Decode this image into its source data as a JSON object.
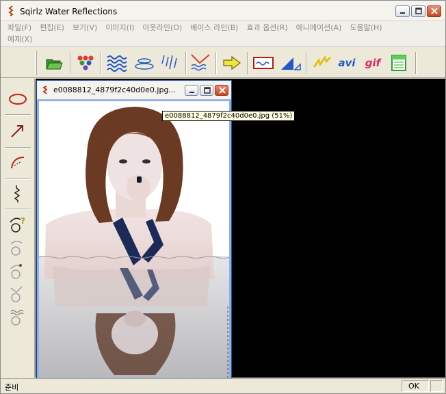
{
  "app": {
    "title": "Sqirlz Water Reflections"
  },
  "menu": {
    "row1": [
      "파일(F)",
      "편집(E)",
      "보기(V)",
      "이미지(I)",
      "아웃라인(O)",
      "베이스 라인(B)",
      "효과 옵션(R)",
      "애니메이션(A)",
      "도움말(H)"
    ],
    "row2": [
      "예제(X)"
    ]
  },
  "toolbar": {
    "buttons": [
      {
        "name": "open-folder-icon"
      },
      {
        "name": "color-dots-icon"
      },
      {
        "name": "waves-icon"
      },
      {
        "name": "ripples-icon"
      },
      {
        "name": "rain-icon"
      },
      {
        "name": "reflection-icon"
      },
      {
        "name": "arrow-right-icon"
      },
      {
        "name": "frame-icon"
      },
      {
        "name": "perspective-icon"
      },
      {
        "name": "lightning-icon"
      },
      {
        "name": "avi",
        "label": "avi"
      },
      {
        "name": "gif",
        "label": "gif"
      },
      {
        "name": "save-frame-icon"
      }
    ]
  },
  "left_tools": [
    {
      "name": "ellipse-tool-icon",
      "enabled": true
    },
    {
      "name": "arrow-tool-icon",
      "enabled": true
    },
    {
      "name": "arc-tool-icon",
      "enabled": true
    },
    {
      "name": "zigzag-tool-icon",
      "enabled": true
    },
    {
      "name": "help-tool-icon",
      "enabled": true
    },
    {
      "name": "tool6-icon",
      "enabled": false
    },
    {
      "name": "tool7-icon",
      "enabled": false
    },
    {
      "name": "tool8-icon",
      "enabled": false
    },
    {
      "name": "tool9-icon",
      "enabled": false
    }
  ],
  "document": {
    "title": "e0088812_4879f2c40d0e0.jpg...",
    "tooltip": "e0088812_4879f2c40d0e0.jpg (51%)"
  },
  "status": {
    "left": "준비",
    "right": "OK"
  },
  "colors": {
    "accent_red": "#c0392b",
    "accent_blue": "#2456c8",
    "gif_color": "#e0246b"
  }
}
